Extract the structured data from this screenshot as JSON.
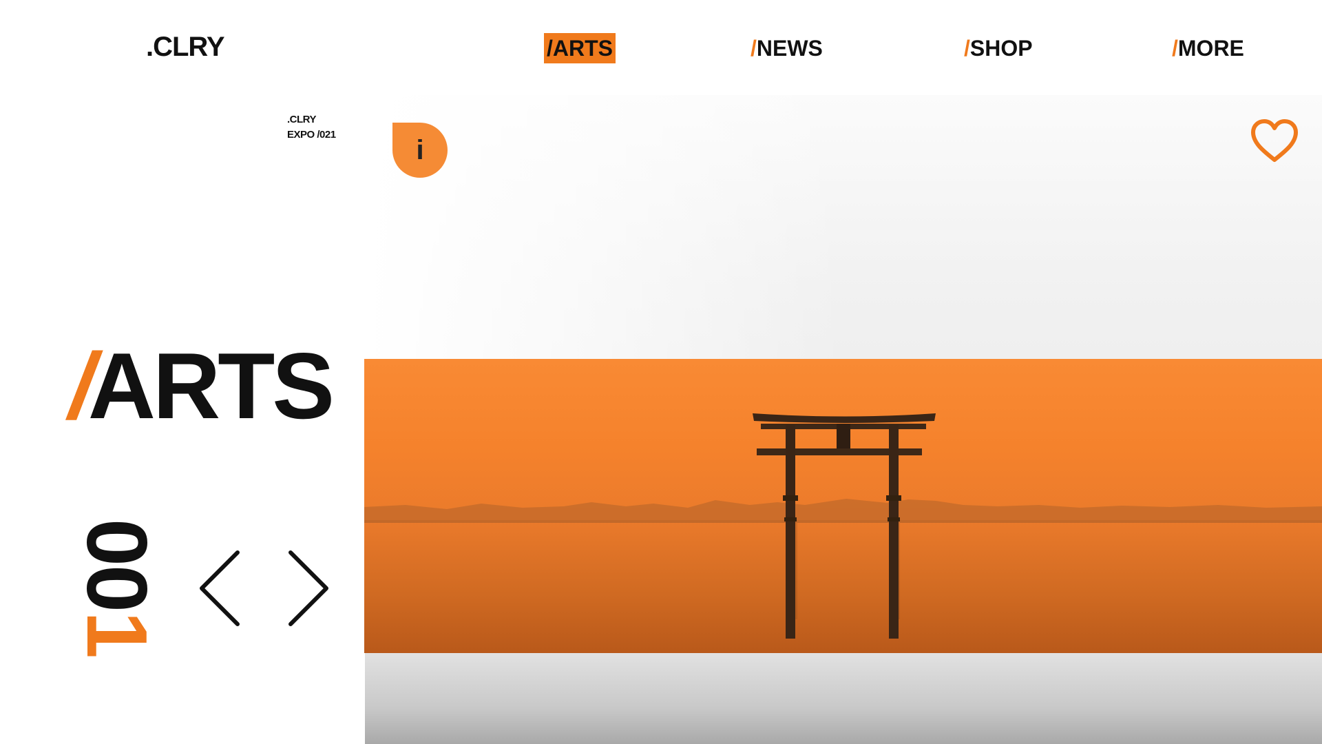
{
  "brand": {
    "logo": ".CLRY"
  },
  "nav": {
    "items": [
      {
        "slash": "/",
        "label": "ARTS",
        "active": true
      },
      {
        "slash": "/",
        "label": "NEWS",
        "active": false
      },
      {
        "slash": "/",
        "label": "SHOP",
        "active": false
      },
      {
        "slash": "/",
        "label": "MORE",
        "active": false
      }
    ]
  },
  "meta": {
    "line1": ".CLRY",
    "line2": "EXPO /021"
  },
  "info_button": {
    "label": "i",
    "icon": "info-icon"
  },
  "favorite": {
    "icon": "heart-icon"
  },
  "hero": {
    "title_slash": "/",
    "title": "ARTS",
    "counter_main": "00",
    "counter_last": "1",
    "prev_icon": "chevron-left-icon",
    "next_icon": "chevron-right-icon"
  },
  "colors": {
    "accent": "#f07a1c",
    "text": "#111111",
    "background": "#ffffff"
  }
}
